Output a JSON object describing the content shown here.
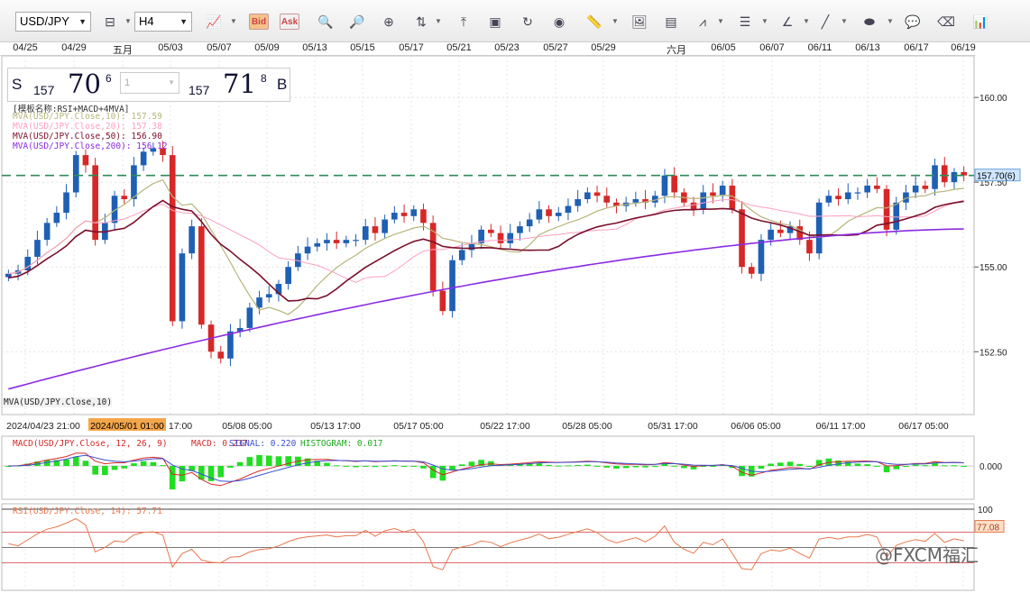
{
  "toolbar": {
    "symbol": "USD/JPY",
    "timeframe": "H4",
    "bid_label": "Bid",
    "ask_label": "Ask"
  },
  "top_dates": [
    "04/25",
    "04/29",
    "五月",
    "05/03",
    "05/07",
    "05/09",
    "05/13",
    "05/15",
    "05/17",
    "05/21",
    "05/23",
    "05/27",
    "05/29",
    "六月",
    "06/05",
    "06/07",
    "06/11",
    "06/13",
    "06/17",
    "06/19"
  ],
  "quote": {
    "sell_label": "S",
    "buy_label": "B",
    "sell_prefix": "157",
    "sell_big": "70",
    "sell_sup": "6",
    "buy_prefix": "157",
    "buy_big": "71",
    "buy_sup": "8",
    "amount_value": "1"
  },
  "legend": {
    "template": "[模板名称:RSI+MACD+4MVA]",
    "mva10": "MVA(USD/JPY.Close,10): 157.59",
    "mva20": "MVA(USD/JPY.Close,20): 157.38",
    "mva50": "MVA(USD/JPY.Close,50): 156.90",
    "mva200": "MVA(USD/JPY.Close,200): 156.12",
    "bottom_label": "MVA(USD/JPY.Close,10)"
  },
  "colors": {
    "mva10": "#b6b57a",
    "mva20": "#ff9fc0",
    "mva50": "#7a0f2a",
    "mva200": "#8a2be2",
    "bull": "#1f5fb4",
    "bear": "#d62828",
    "macd": "#d62828",
    "signal": "#3a4fd0",
    "histogram": "#22dd22",
    "rsi": "#e8784e",
    "price_line": "#2e8b57"
  },
  "price_axis": {
    "ticks": [
      "160.00",
      "157.50",
      "155.00",
      "152.50"
    ],
    "current_label": "157.70(6)"
  },
  "bottom_dates": {
    "labels": [
      "2024/04/23 21:00",
      "05/08 05:00",
      "05/13 17:00",
      "05/17 05:00",
      "05/22 17:00",
      "05/28 05:00",
      "05/31 17:00",
      "06/06 05:00",
      "06/11 17:00",
      "06/17 05:00"
    ],
    "highlight": "2024/05/01 01:00",
    "highlight_suffix": "17:00"
  },
  "macd": {
    "label_name": "MACD(USD/JPY.Close, 12, 26, 9)",
    "label_macd": "MACD: 0.237",
    "label_signal": "SIGNAL: 0.220",
    "label_hist": "HISTOGRAM: 0.017",
    "zero_label": "0.000"
  },
  "rsi": {
    "label": "RSI(USD/JPY.Close, 14): 57.71",
    "top_label": "100",
    "value_label": "77.08"
  },
  "watermark": "@FXCM福汇",
  "chart_data": {
    "type": "candlestick",
    "symbol": "USD/JPY",
    "timeframe": "H4",
    "ylim": [
      150.7,
      161.2
    ],
    "closes": [
      154.8,
      154.9,
      155.3,
      155.8,
      156.3,
      156.6,
      157.2,
      158.3,
      158.0,
      155.8,
      156.3,
      157.1,
      157.0,
      158.0,
      158.4,
      158.5,
      158.3,
      153.4,
      155.4,
      156.2,
      153.3,
      152.5,
      152.3,
      153.1,
      153.2,
      153.8,
      154.1,
      154.2,
      154.5,
      155.0,
      155.4,
      155.6,
      155.7,
      155.8,
      155.7,
      155.8,
      155.8,
      156.2,
      156.0,
      156.4,
      156.6,
      156.5,
      156.7,
      156.3,
      154.3,
      153.7,
      155.2,
      155.5,
      155.7,
      156.1,
      156.0,
      155.7,
      156.0,
      156.2,
      156.4,
      156.7,
      156.5,
      156.6,
      156.8,
      157.0,
      157.2,
      157.1,
      156.9,
      156.8,
      156.9,
      157.0,
      156.9,
      157.1,
      157.7,
      157.2,
      156.9,
      156.7,
      157.2,
      157.1,
      157.4,
      156.7,
      155.0,
      154.8,
      155.8,
      156.1,
      156.0,
      156.2,
      155.8,
      155.4,
      156.9,
      157.1,
      157.0,
      157.2,
      157.2,
      157.4,
      157.3,
      156.1,
      156.9,
      157.2,
      157.4,
      157.3,
      158.0,
      157.5,
      157.8,
      157.7
    ],
    "mva10_last": 157.59,
    "mva20_last": 157.38,
    "mva50_last": 156.9,
    "mva200_last": 156.12,
    "current_price": 157.7,
    "macd": 0.237,
    "signal": 0.22,
    "histogram": 0.017,
    "rsi": 57.71,
    "rsi_levels": [
      70,
      50,
      30
    ]
  }
}
